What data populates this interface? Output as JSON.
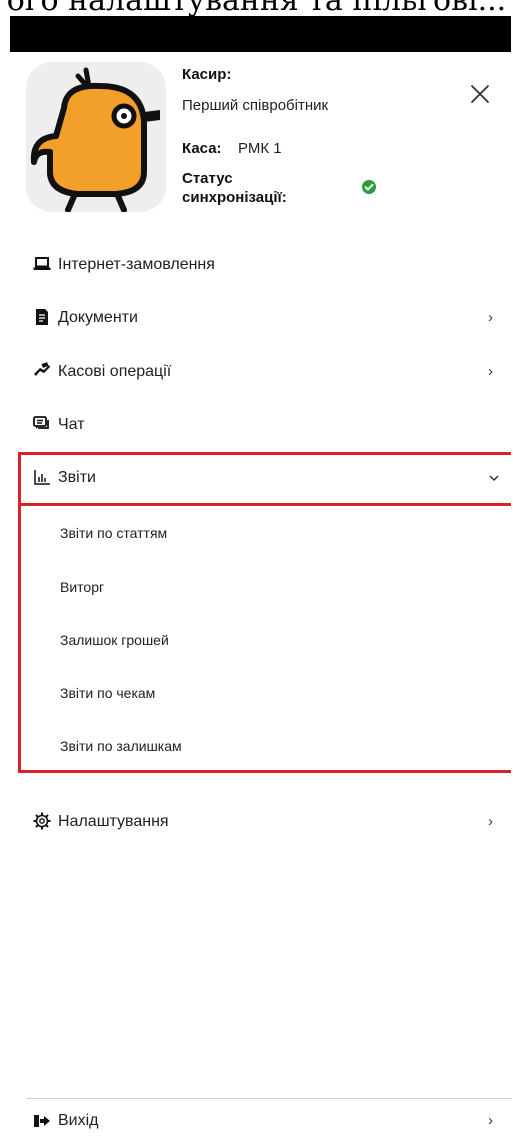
{
  "header": {
    "caption": "ого налаштування та пільгові...",
    "cashier_label": "Касир:",
    "cashier_value": "Перший співробітник",
    "register_label": "Каса:",
    "register_value": "РМК 1",
    "sync_label_line1": "Статус",
    "sync_label_line2": "синхронізації:",
    "sync_status_icon": "check-circle-icon",
    "close_icon": "close-icon"
  },
  "menu": {
    "items": [
      {
        "label": "Інтернет-замовлення",
        "icon": "laptop-icon",
        "has_chevron": false
      },
      {
        "label": "Документи",
        "icon": "document-icon",
        "chevron": "›"
      },
      {
        "label": "Касові операції",
        "icon": "money-hand-icon",
        "chevron": "›"
      },
      {
        "label": "Чат",
        "icon": "chat-icon",
        "has_chevron": false
      },
      {
        "label": "Звіти",
        "icon": "bar-chart-icon",
        "chevron": "⌄",
        "expanded": true
      },
      {
        "label": "Налаштування",
        "icon": "gear-icon",
        "chevron": "›"
      },
      {
        "label": "Вихід",
        "icon": "logout-icon",
        "chevron": "›"
      }
    ],
    "reports_submenu": [
      "Звіти по статтям",
      "Виторг",
      "Залишок грошей",
      "Звіти по чекам",
      "Звіти по залишкам"
    ]
  },
  "colors": {
    "highlight_border": "#d8232a",
    "sync_ok": "#2e9e3a",
    "logo_bird": "#f3a02b"
  }
}
